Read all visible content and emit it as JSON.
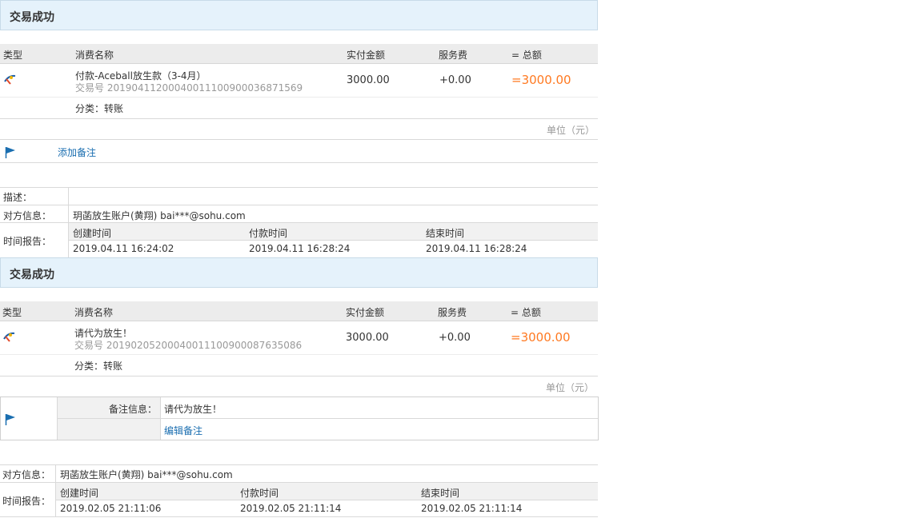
{
  "headers": {
    "type": "类型",
    "name": "消费名称",
    "paid": "实付金额",
    "fee": "服务费",
    "total": "= 总额"
  },
  "unit_label": "单位（元）",
  "classify_label": "分类：",
  "colors": {
    "accent": "#ff7a22",
    "link": "#1a6eb0",
    "title_bg": "#e5f2fb",
    "flag": "#1a6eb0"
  },
  "trade1": {
    "status": "交易成功",
    "name": "付款-Aceball放生款（3-4月）",
    "trade_no": "交易号 2019041120004001110090003687156 9",
    "trade_no_text": "交易号 20190411200040011100900036871569",
    "paid": "3000.00",
    "fee": "+0.00",
    "total": "=3000.00",
    "category": "转账",
    "add_note": "添加备注",
    "desc_label": "描述：",
    "desc_value": "",
    "party_label": "对方信息：",
    "party_value": "玥菡放生账户(黄翔) bai***@sohu.com",
    "time_label": "时间报告：",
    "create_label": "创建时间",
    "pay_label": "付款时间",
    "end_label": "结束时间",
    "create_time": "2019.04.11 16:24:02",
    "pay_time": "2019.04.11 16:28:24",
    "end_time": "2019.04.11 16:28:24"
  },
  "trade2": {
    "status": "交易成功",
    "name": "请代为放生！",
    "trade_no_text": "交易号 20190205200040011100900087635086",
    "paid": "3000.00",
    "fee": "+0.00",
    "total": "=3000.00",
    "category": "转账",
    "note_label": "备注信息：",
    "note_value": "请代为放生！",
    "edit_note": "编辑备注",
    "party_label": "对方信息：",
    "party_value": "玥菡放生账户(黄翔) bai***@sohu.com",
    "time_label": "时间报告：",
    "create_label": "创建时间",
    "pay_label": "付款时间",
    "end_label": "结束时间",
    "create_time": "2019.02.05 21:11:06",
    "pay_time": "2019.02.05 21:11:14",
    "end_time": "2019.02.05 21:11:14"
  }
}
